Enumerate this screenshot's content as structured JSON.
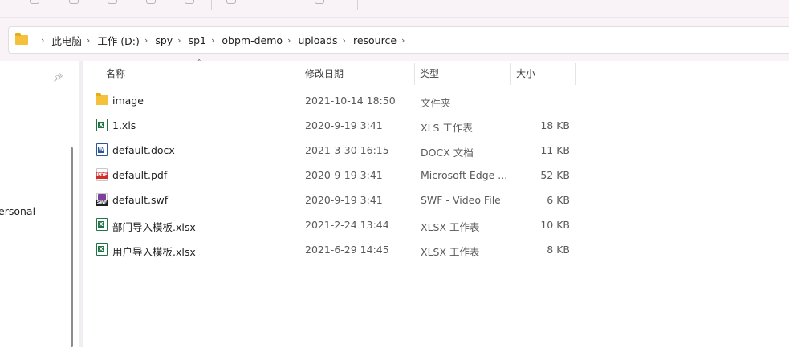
{
  "breadcrumb": [
    "此电脑",
    "工作 (D:)",
    "spy",
    "sp1",
    "obpm-demo",
    "uploads",
    "resource"
  ],
  "nav": {
    "label": "ersonal"
  },
  "columns": {
    "name": "名称",
    "date": "修改日期",
    "type": "类型",
    "size": "大小"
  },
  "files": [
    {
      "icon": "folder-icon",
      "name": "image",
      "date": "2021-10-14 18:50",
      "type": "文件夹",
      "size": ""
    },
    {
      "icon": "excel-file-icon",
      "name": "1.xls",
      "date": "2020-9-19 3:41",
      "type": "XLS 工作表",
      "size": "18 KB"
    },
    {
      "icon": "word-file-icon",
      "name": "default.docx",
      "date": "2021-3-30 16:15",
      "type": "DOCX 文档",
      "size": "11 KB"
    },
    {
      "icon": "pdf-file-icon",
      "name": "default.pdf",
      "date": "2020-9-19 3:41",
      "type": "Microsoft Edge ...",
      "size": "52 KB"
    },
    {
      "icon": "swf-file-icon",
      "name": "default.swf",
      "date": "2020-9-19 3:41",
      "type": "SWF - Video File",
      "size": "6 KB"
    },
    {
      "icon": "excel-file-icon",
      "name": "部门导入模板.xlsx",
      "date": "2021-2-24 13:44",
      "type": "XLSX 工作表",
      "size": "10 KB"
    },
    {
      "icon": "excel-file-icon",
      "name": "用户导入模板.xlsx",
      "date": "2021-6-29 14:45",
      "type": "XLSX 工作表",
      "size": "8 KB"
    }
  ]
}
